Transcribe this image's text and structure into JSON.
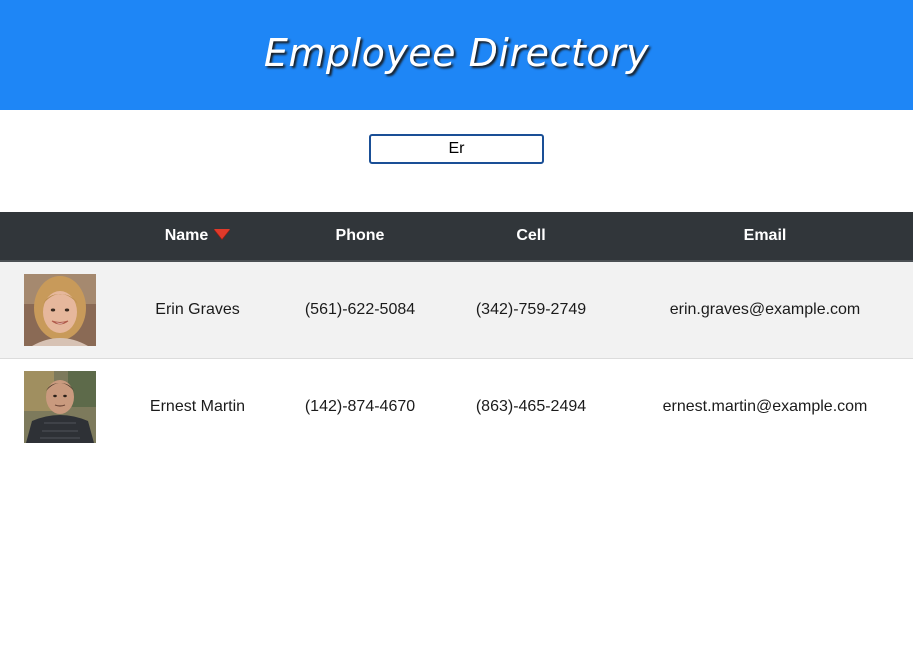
{
  "header": {
    "title": "Employee Directory"
  },
  "search": {
    "value": "Er",
    "placeholder": ""
  },
  "table": {
    "columns": [
      "",
      "Name",
      "Phone",
      "Cell",
      "Email"
    ],
    "sort": {
      "column": "Name",
      "direction": "descending",
      "indicator_color": "#e03a2a"
    },
    "rows": [
      {
        "avatar": "woman-portrait",
        "name": "Erin Graves",
        "phone": "(561)-622-5084",
        "cell": "(342)-759-2749",
        "email": "erin.graves@example.com"
      },
      {
        "avatar": "man-portrait",
        "name": "Ernest Martin",
        "phone": "(142)-874-4670",
        "cell": "(863)-465-2494",
        "email": "ernest.martin@example.com"
      }
    ]
  },
  "colors": {
    "header_bg": "#1e86f6",
    "table_header_bg": "#31363a",
    "row_shaded_bg": "#f2f2f2",
    "search_border": "#1a4f96"
  }
}
